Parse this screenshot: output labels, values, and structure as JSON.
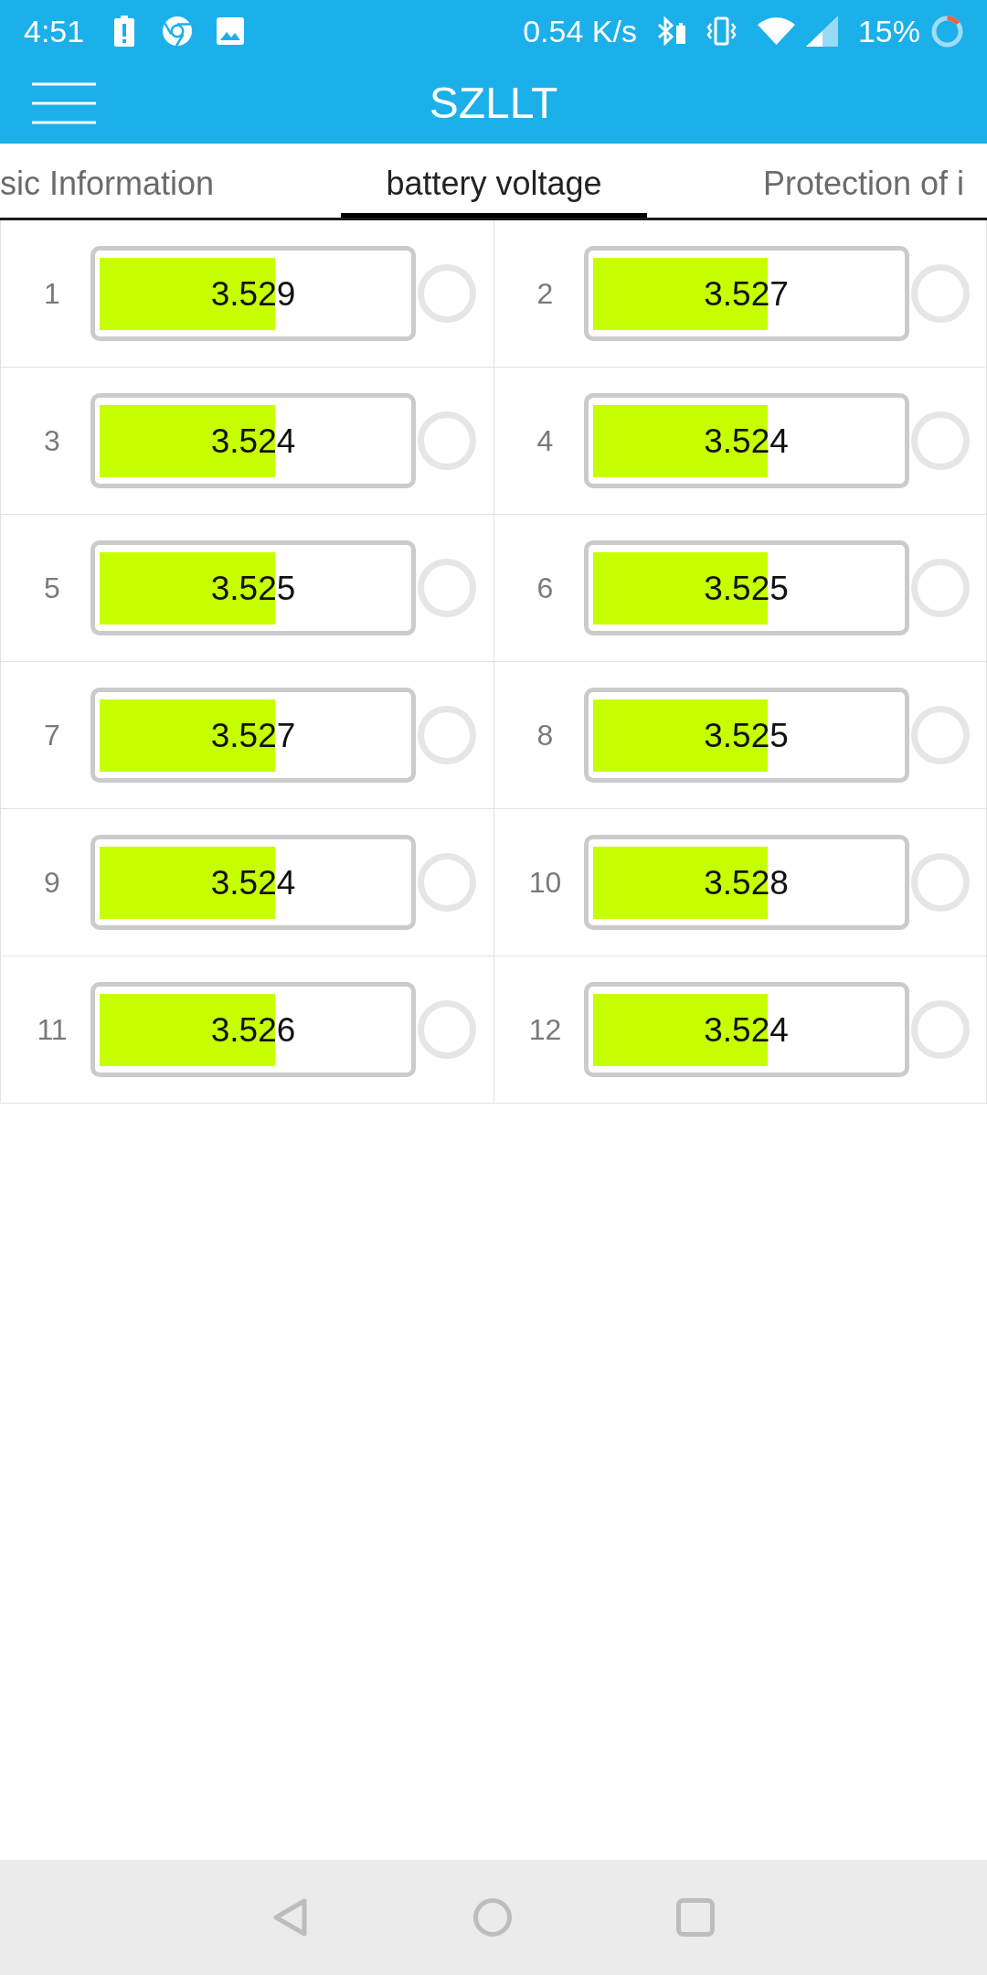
{
  "status_bar": {
    "time": "4:51",
    "net_speed": "0.54 K/s",
    "battery": "15%"
  },
  "toolbar": {
    "title": "SZLLT"
  },
  "tabs": [
    {
      "label": "sic Information",
      "selected": false
    },
    {
      "label": "battery voltage",
      "selected": true
    },
    {
      "label": "Protection of i",
      "selected": false
    }
  ],
  "cells": [
    {
      "index": "1",
      "voltage": "3.529",
      "level": 0.57,
      "indicator_on": false
    },
    {
      "index": "2",
      "voltage": "3.527",
      "level": 0.57,
      "indicator_on": false
    },
    {
      "index": "3",
      "voltage": "3.524",
      "level": 0.57,
      "indicator_on": false
    },
    {
      "index": "4",
      "voltage": "3.524",
      "level": 0.57,
      "indicator_on": false
    },
    {
      "index": "5",
      "voltage": "3.525",
      "level": 0.57,
      "indicator_on": false
    },
    {
      "index": "6",
      "voltage": "3.525",
      "level": 0.57,
      "indicator_on": false
    },
    {
      "index": "7",
      "voltage": "3.527",
      "level": 0.57,
      "indicator_on": false
    },
    {
      "index": "8",
      "voltage": "3.525",
      "level": 0.57,
      "indicator_on": false
    },
    {
      "index": "9",
      "voltage": "3.524",
      "level": 0.57,
      "indicator_on": false
    },
    {
      "index": "10",
      "voltage": "3.528",
      "level": 0.57,
      "indicator_on": false
    },
    {
      "index": "11",
      "voltage": "3.526",
      "level": 0.57,
      "indicator_on": false
    },
    {
      "index": "12",
      "voltage": "3.524",
      "level": 0.57,
      "indicator_on": false
    }
  ]
}
